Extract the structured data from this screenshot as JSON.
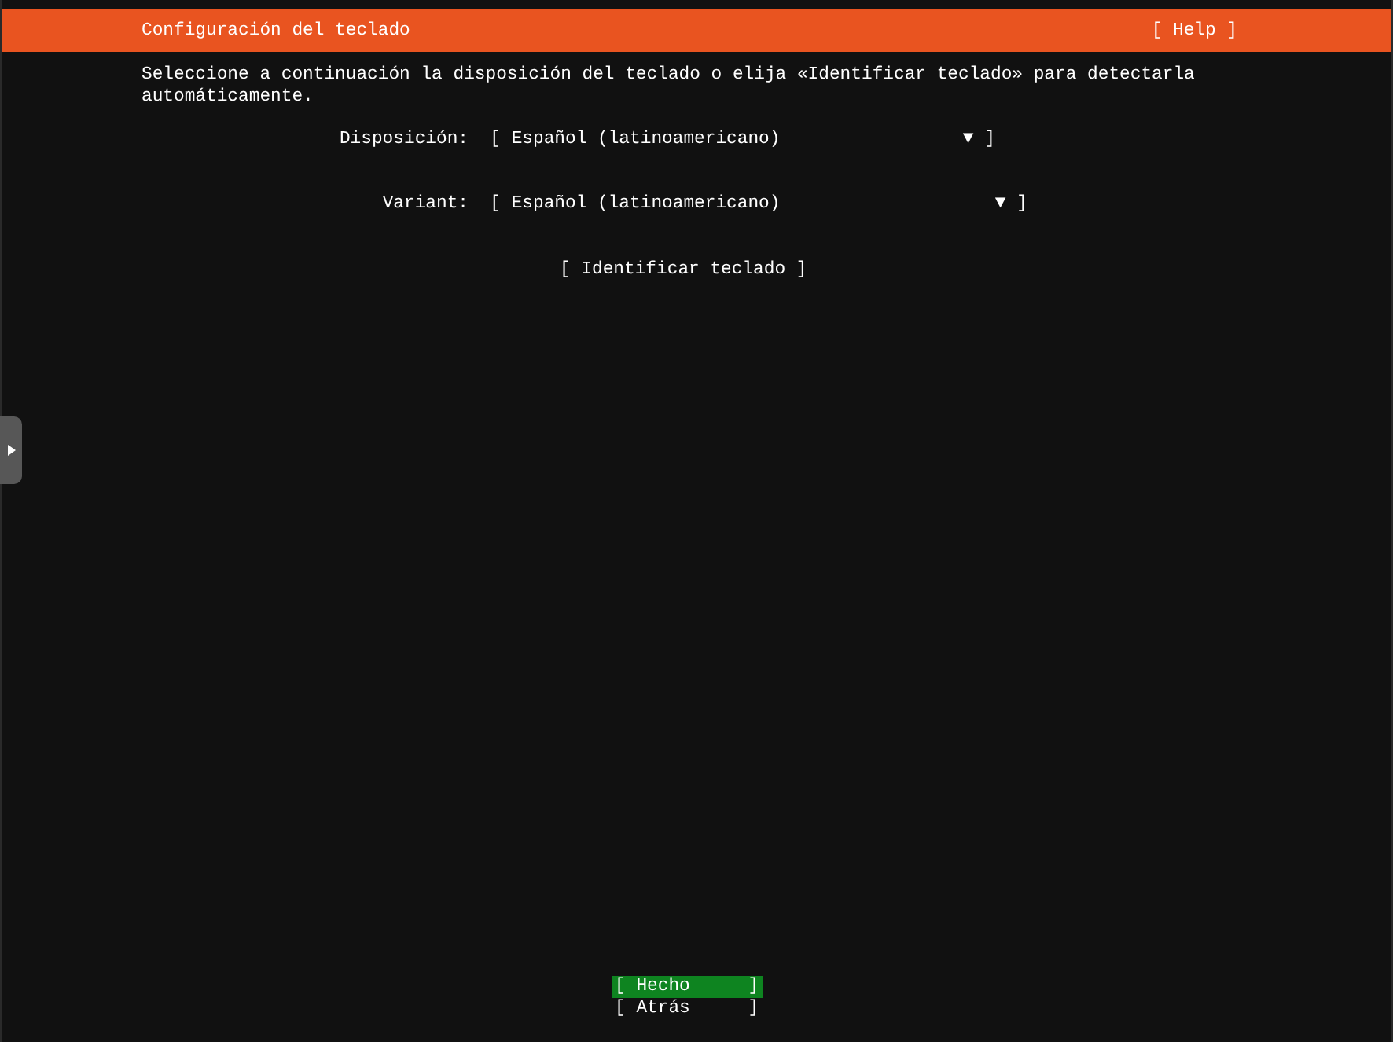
{
  "header": {
    "title": "Configuración del teclado",
    "help": "[ Help ]"
  },
  "description": "Seleccione a continuación la disposición del teclado o elija «Identificar teclado» para detectarla automáticamente.",
  "fields": [
    {
      "label": "Disposición:",
      "left": "[",
      "value": "Español (latinoamericano)",
      "caret": "▼",
      "right": "]"
    },
    {
      "label": "Variant:",
      "left": "[",
      "value": "Español (latinoamericano)",
      "caret": "▼",
      "right": "]"
    }
  ],
  "identify_button": "[ Identificar teclado ]",
  "buttons": [
    {
      "left": "[",
      "label": "Hecho",
      "right": "]",
      "selected": true
    },
    {
      "left": "[",
      "label": "Atrás",
      "right": "]",
      "selected": false
    }
  ]
}
